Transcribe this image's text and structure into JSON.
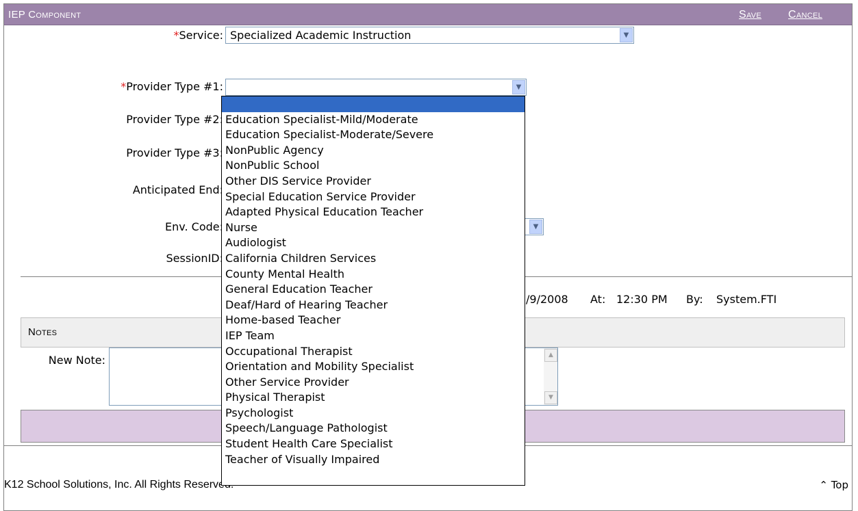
{
  "panel": {
    "title": "IEP Component",
    "save_label": "Save",
    "cancel_label": "Cancel"
  },
  "form": {
    "required_mark": "*",
    "service_label": "Service:",
    "service_value": "Specialized Academic Instruction",
    "provider1_label": "Provider Type #1:",
    "provider1_value": "",
    "provider2_label": "Provider Type #2:",
    "provider3_label": "Provider Type #3:",
    "anticipated_end_label": "Anticipated End:",
    "env_code_label": "Env. Code:",
    "session_label": "SessionID:"
  },
  "audit": {
    "date_partial": "/9/2008",
    "at_label": "At:",
    "time": "12:30 PM",
    "by_label": "By:",
    "user": "System.FTI"
  },
  "notes": {
    "header": "Notes",
    "new_note_label": "New Note:"
  },
  "footer": {
    "text": "K12 School Solutions, Inc. All Rights Reserved.",
    "top_link": "Top"
  },
  "provider_options": [
    "",
    "Education Specialist-Mild/Moderate",
    "Education Specialist-Moderate/Severe",
    "NonPublic Agency",
    "NonPublic School",
    "Other DIS Service Provider",
    "Special Education Service Provider",
    "Adapted Physical Education Teacher",
    "Nurse",
    "Audiologist",
    "California Children Services",
    "County Mental Health",
    "General Education Teacher",
    "Deaf/Hard of Hearing Teacher",
    "Home-based Teacher",
    "IEP Team",
    "Occupational Therapist",
    "Orientation and Mobility Specialist",
    "Other Service Provider",
    "Physical Therapist",
    "Psychologist",
    "Speech/Language Pathologist",
    "Student Health Care Specialist",
    "Teacher of Visually Impaired"
  ],
  "colors": {
    "title_bar": "#9c84aa",
    "selection": "#316ac5",
    "footer_bar": "#dcc9e2",
    "required": "#e02020"
  },
  "icons": {
    "dropdown_arrow": "chevron-down-icon",
    "scroll_up": "arrow-up-icon",
    "scroll_down": "arrow-down-icon"
  }
}
